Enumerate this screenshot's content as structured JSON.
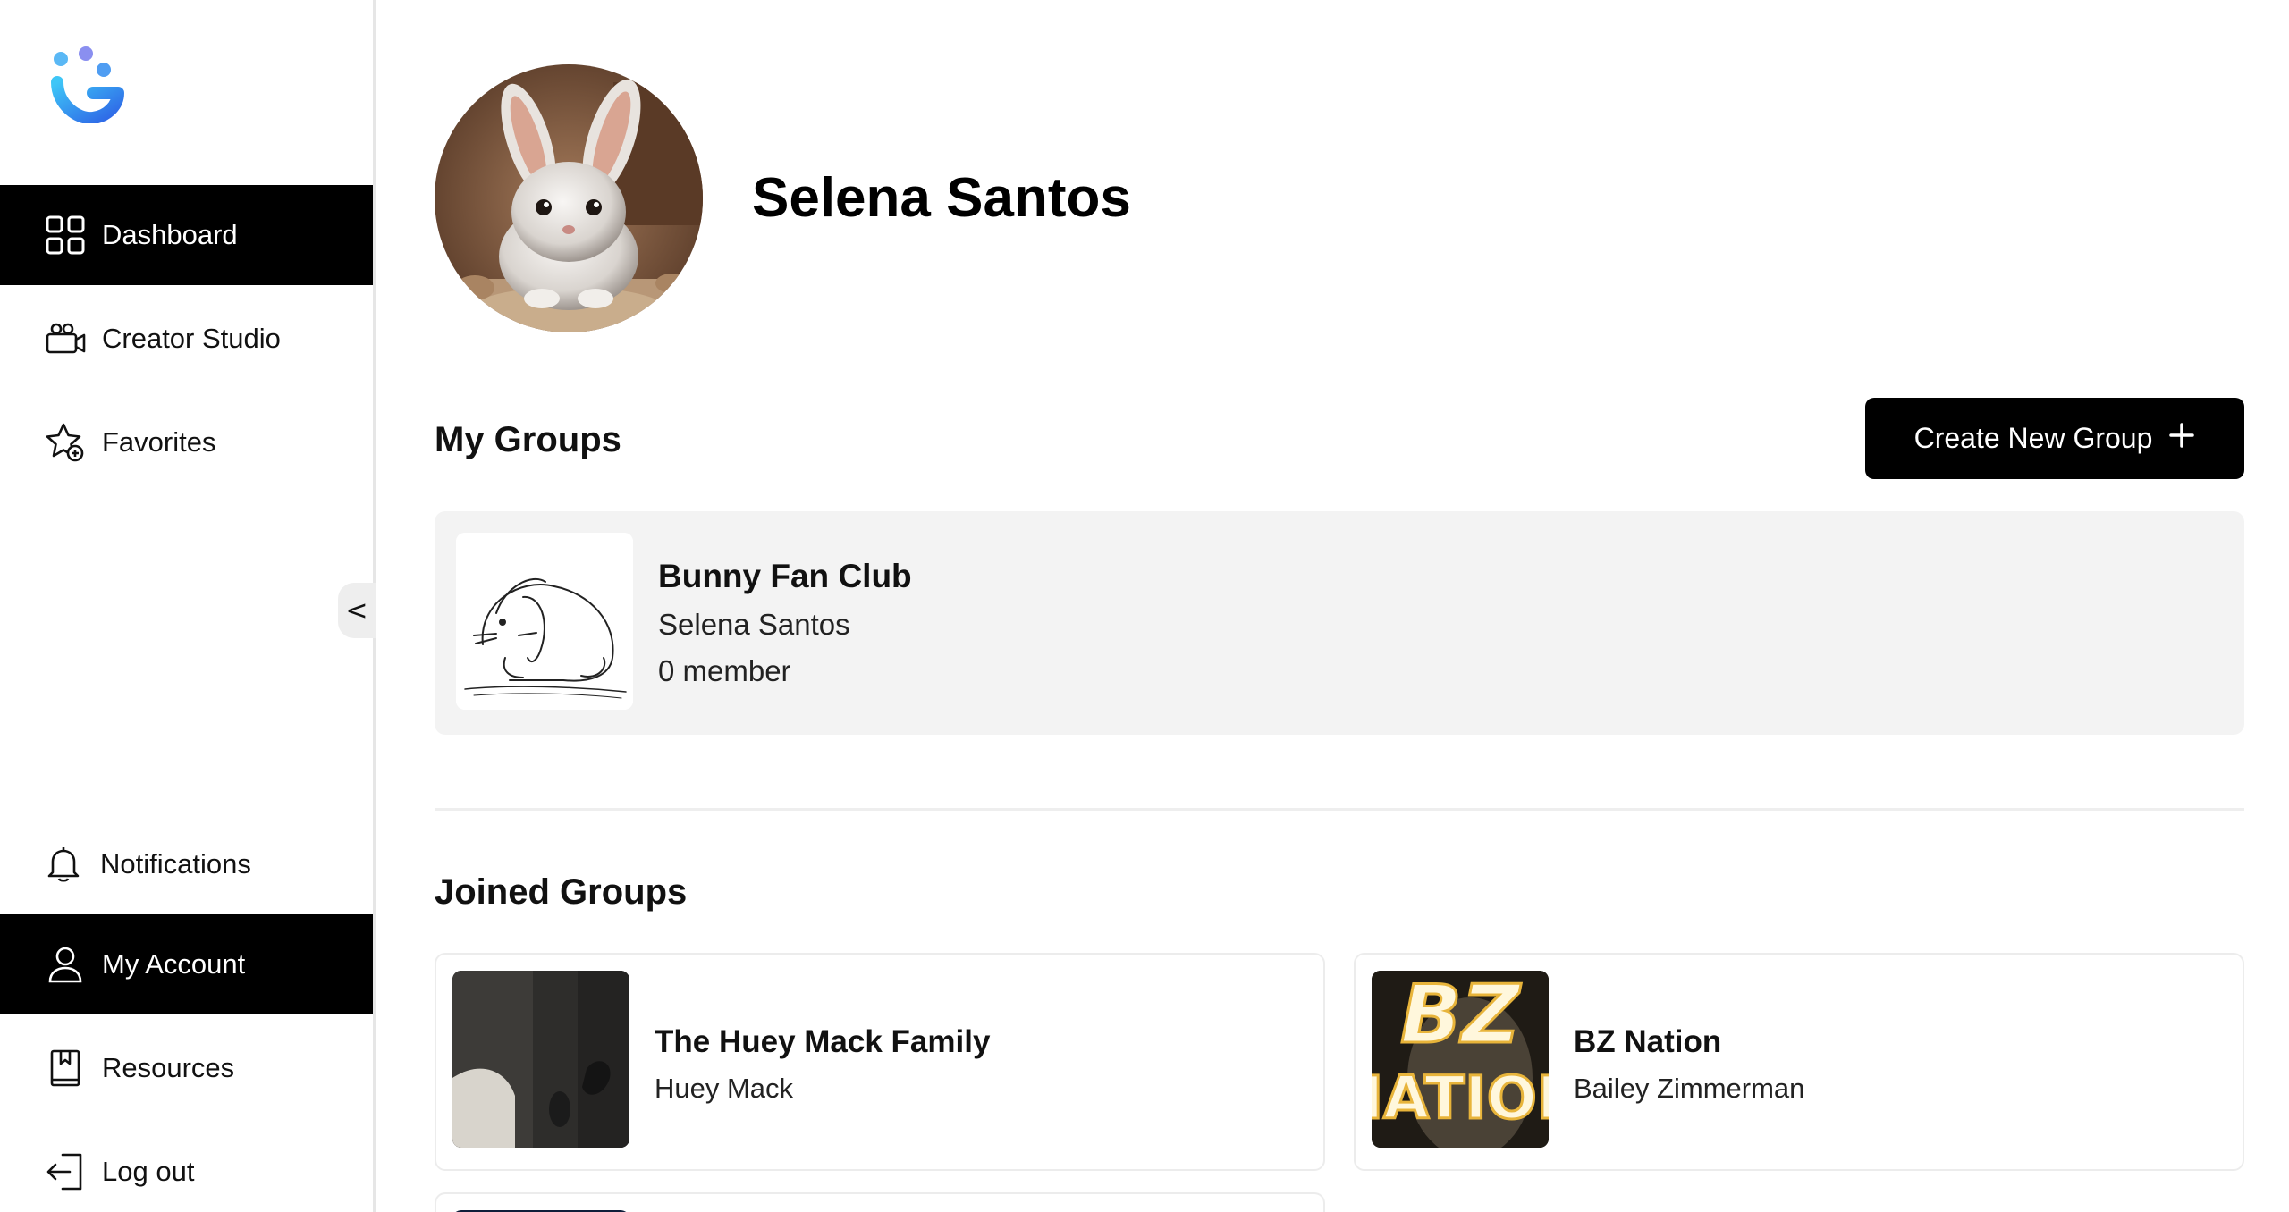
{
  "sidebar": {
    "logo_icon": "brand-logo-icon",
    "nav_top": [
      {
        "label": "Dashboard",
        "icon": "grid-icon",
        "active": true
      },
      {
        "label": "Creator Studio",
        "icon": "video-camera-icon",
        "active": false
      },
      {
        "label": "Favorites",
        "icon": "star-icon",
        "active": false
      }
    ],
    "nav_bottom": [
      {
        "label": "Notifications",
        "icon": "bell-icon",
        "active": false
      },
      {
        "label": "My Account",
        "icon": "user-icon",
        "active": true
      },
      {
        "label": "Resources",
        "icon": "book-icon",
        "active": false
      },
      {
        "label": "Log out",
        "icon": "logout-icon",
        "active": false
      }
    ],
    "collapse_label": "<"
  },
  "profile": {
    "name": "Selena Santos",
    "avatar": "bunny-photo"
  },
  "my_groups": {
    "title": "My Groups",
    "create_button": "Create New Group",
    "items": [
      {
        "name": "Bunny Fan Club",
        "owner": "Selena Santos",
        "members": "0 member",
        "thumbnail": "bunny-sketch"
      }
    ]
  },
  "joined_groups": {
    "title": "Joined Groups",
    "items": [
      {
        "name": "The Huey Mack Family",
        "owner": "Huey Mack",
        "thumbnail": "dark-photo"
      },
      {
        "name": "BZ Nation",
        "owner": "Bailey Zimmerman",
        "thumbnail": "bz-nation-graphic"
      }
    ]
  },
  "colors": {
    "accent": "#000000",
    "active_text": "#ffffff",
    "card_bg": "#f3f3f3",
    "logo_gradient": [
      "#39c3f5",
      "#2f6ee8"
    ]
  }
}
